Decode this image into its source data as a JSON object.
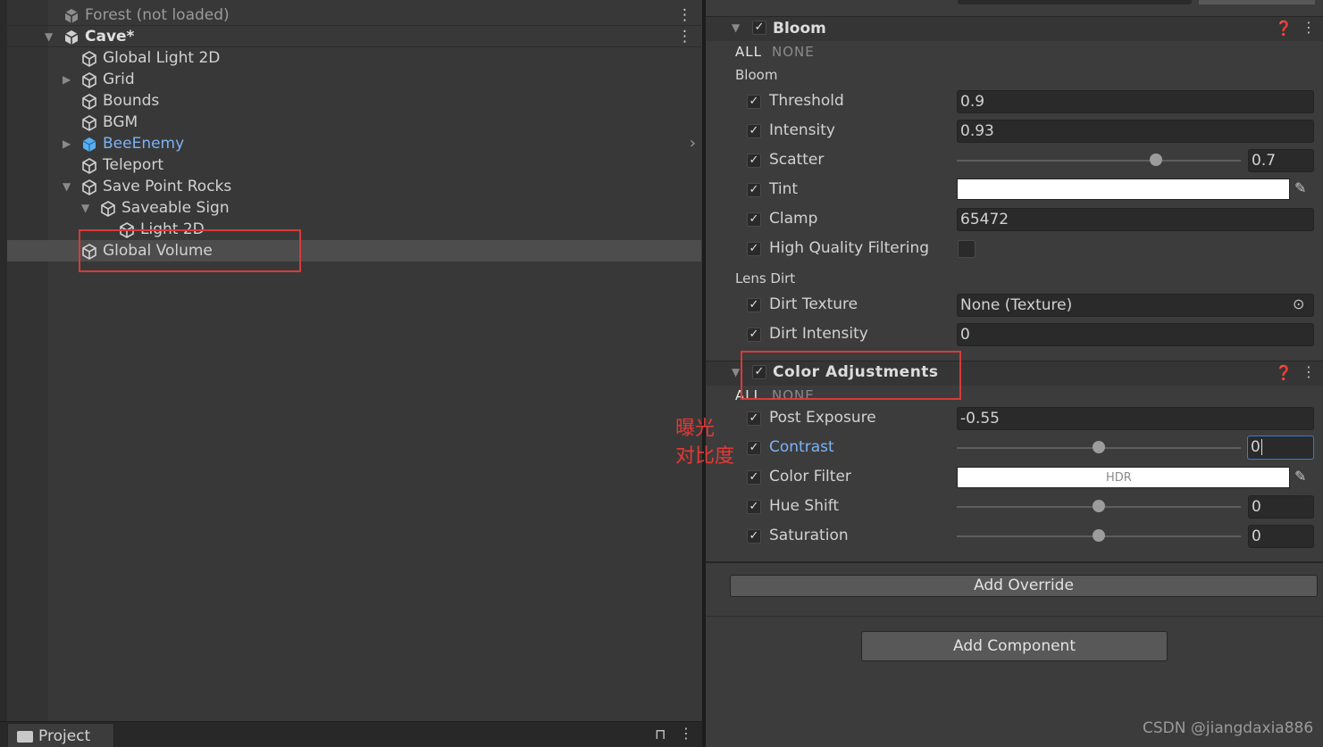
{
  "hierarchy": {
    "rows": [
      {
        "label": "Forest (not loaded)",
        "arrow": "",
        "icon": "scene-icon",
        "muted": true
      },
      {
        "label": "Cave*",
        "arrow": "down",
        "icon": "scene-icon",
        "bold": true
      },
      {
        "label": "Global Light 2D",
        "arrow": "",
        "icon": "cube-icon"
      },
      {
        "label": "Grid",
        "arrow": "right",
        "icon": "cube-icon"
      },
      {
        "label": "Bounds",
        "arrow": "",
        "icon": "cube-icon"
      },
      {
        "label": "BGM",
        "arrow": "",
        "icon": "cube-icon"
      },
      {
        "label": "BeeEnemy",
        "arrow": "right",
        "icon": "prefab-icon",
        "prefab": true
      },
      {
        "label": "Teleport",
        "arrow": "",
        "icon": "cube-icon"
      },
      {
        "label": "Save Point Rocks",
        "arrow": "down",
        "icon": "cube-icon"
      },
      {
        "label": "Saveable Sign",
        "arrow": "down",
        "icon": "cube-icon"
      },
      {
        "label": "Light 2D",
        "arrow": "",
        "icon": "cube-icon"
      },
      {
        "label": "Global Volume",
        "arrow": "",
        "icon": "cube-icon",
        "selected": true
      }
    ],
    "project_tab": "Project"
  },
  "inspector": {
    "bloom": {
      "title": "Bloom",
      "all": "ALL",
      "none": "NONE",
      "section_bloom": "Bloom",
      "threshold_label": "Threshold",
      "threshold": "0.9",
      "intensity_label": "Intensity",
      "intensity": "0.93",
      "scatter_label": "Scatter",
      "scatter": "0.7",
      "scatter_fraction": 0.7,
      "tint_label": "Tint",
      "tint_color": "#ffffff",
      "clamp_label": "Clamp",
      "clamp": "65472",
      "hqf_label": "High Quality Filtering",
      "hqf": false,
      "section_lens": "Lens Dirt",
      "dirt_texture_label": "Dirt Texture",
      "dirt_texture": "None (Texture)",
      "dirt_intensity_label": "Dirt Intensity",
      "dirt_intensity": "0"
    },
    "color_adjustments": {
      "title": "Color Adjustments",
      "all": "ALL",
      "none": "NONE",
      "post_exposure_label": "Post Exposure",
      "post_exposure": "-0.55",
      "contrast_label": "Contrast",
      "contrast": "0",
      "contrast_fraction": 0.5,
      "color_filter_label": "Color Filter",
      "color_filter_badge": "HDR",
      "color_filter_color": "#ffffff",
      "hue_shift_label": "Hue Shift",
      "hue_shift": "0",
      "hue_shift_fraction": 0.5,
      "saturation_label": "Saturation",
      "saturation": "0",
      "saturation_fraction": 0.5
    },
    "add_override": "Add Override",
    "add_component": "Add Component"
  },
  "annotations": {
    "exposure_note": "曝光",
    "contrast_note": "对比度",
    "watermark": "CSDN @jiangdaxia886"
  },
  "colors": {
    "accent_blue": "#7cb3f5",
    "annotation_red": "#e53935"
  }
}
